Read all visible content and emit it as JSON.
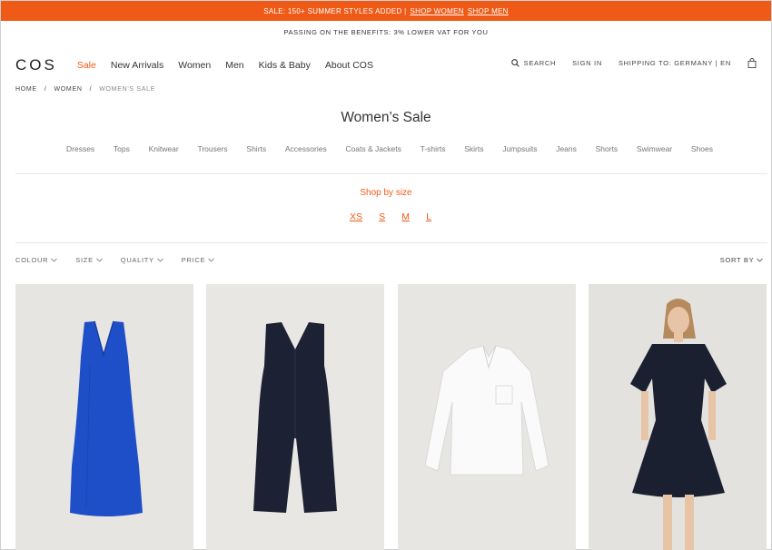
{
  "promo": {
    "text": "SALE: 150+ SUMMER STYLES ADDED |",
    "shop_women": "SHOP WOMEN",
    "shop_men": "SHOP MEN",
    "bg_color": "#ef5a17"
  },
  "vat_banner": "PASSING ON THE BENEFITS: 3% LOWER VAT FOR YOU",
  "header": {
    "logo": "COS",
    "nav": [
      "Sale",
      "New Arrivals",
      "Women",
      "Men",
      "Kids & Baby",
      "About COS"
    ],
    "search": "SEARCH",
    "sign_in": "SIGN IN",
    "shipping": "SHIPPING TO: GERMANY | EN"
  },
  "breadcrumb": [
    "HOME",
    "/",
    "WOMEN",
    "/",
    "WOMEN'S SALE"
  ],
  "page_title": "Women’s Sale",
  "categories": [
    "Dresses",
    "Tops",
    "Knitwear",
    "Trousers",
    "Shirts",
    "Accessories",
    "Coats & Jackets",
    "T-shirts",
    "Skirts",
    "Jumpsuits",
    "Jeans",
    "Shorts",
    "Swimwear",
    "Shoes"
  ],
  "shop_by_size": {
    "label": "Shop by size",
    "sizes": [
      "XS",
      "S",
      "M",
      "L"
    ]
  },
  "filters": [
    "COLOUR",
    "SIZE",
    "QUALITY",
    "PRICE"
  ],
  "sort_label": "SORT BY",
  "icons": {
    "search": "search-icon",
    "bag": "shopping-bag-icon",
    "chevron": "chevron-down-icon"
  },
  "colors": {
    "accent": "#ef5a17",
    "blue_dress": "#1f4fc8",
    "navy": "#1c2233"
  },
  "products": [
    {
      "image": "blue-sleeveless-dress"
    },
    {
      "image": "navy-sleeveless-jumpsuit"
    },
    {
      "image": "white-shirt"
    },
    {
      "image": "model-in-navy-dress"
    }
  ]
}
